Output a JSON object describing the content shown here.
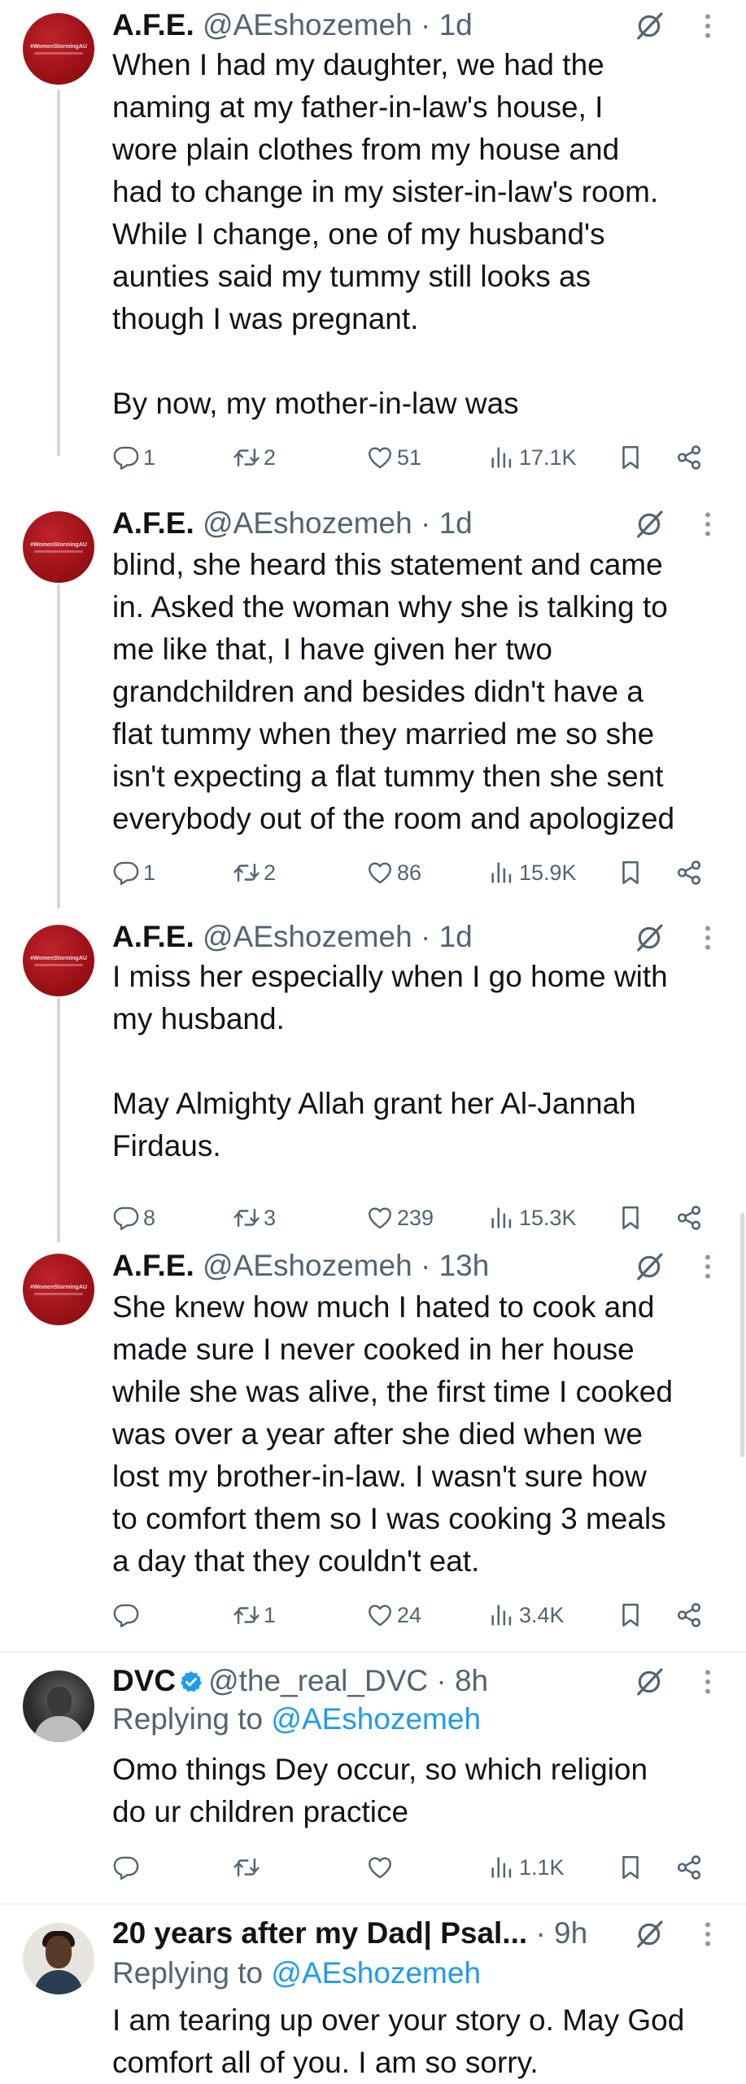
{
  "tweets": [
    {
      "name": "A.F.E.",
      "handle": "@AEshozemeh",
      "time": "1d",
      "avatar_text": "#WomenStormingAU",
      "text": "When I had my daughter, we had the\nnaming at my father-in-law's house, I\nwore plain clothes from my house and\nhad to change in my sister-in-law's room.\nWhile I change, one of my husband's\naunties said my tummy still looks as\nthough I was pregnant.\n\nBy now, my mother-in-law was",
      "replies": "1",
      "retweets": "2",
      "likes": "51",
      "views": "17.1K"
    },
    {
      "name": "A.F.E.",
      "handle": "@AEshozemeh",
      "time": "1d",
      "avatar_text": "#WomenStormingAU",
      "text": "blind, she heard this statement and came\nin. Asked the woman why she is talking to\nme like that, I have given her two\ngrandchildren and besides didn't have a\nflat tummy when they married me so she\nisn't expecting a flat tummy then she sent\neverybody out of the room and apologized",
      "replies": "1",
      "retweets": "2",
      "likes": "86",
      "views": "15.9K"
    },
    {
      "name": "A.F.E.",
      "handle": "@AEshozemeh",
      "time": "1d",
      "avatar_text": "#WomenStormingAU",
      "text": "I miss her especially when I go home with\nmy husband.\n\nMay Almighty Allah grant her Al-Jannah\nFirdaus.",
      "replies": "8",
      "retweets": "3",
      "likes": "239",
      "views": "15.3K"
    },
    {
      "name": "A.F.E.",
      "handle": "@AEshozemeh",
      "time": "13h",
      "avatar_text": "#WomenStormingAU",
      "text": "She knew how much I hated to cook and\nmade sure I never cooked in her house\nwhile she was alive, the first time I cooked\nwas over a year after she died when we\nlost my brother-in-law. I wasn't sure how\nto comfort them so I was cooking 3 meals\na day that they couldn't eat.",
      "replies": "",
      "retweets": "1",
      "likes": "24",
      "views": "3.4K"
    },
    {
      "name": "DVC",
      "handle": "@the_real_DVC",
      "time": "8h",
      "replying_prefix": "Replying to",
      "replying_to": "@AEshozemeh",
      "text": "Omo things Dey occur, so which religion\ndo ur children practice",
      "replies": "",
      "retweets": "",
      "likes": "",
      "views": "1.1K",
      "accent": "#1d9bf0"
    },
    {
      "name": "20 years after my Dad| Psal...",
      "handle": "",
      "time": "9h",
      "replying_prefix": "Replying to",
      "replying_to": "@AEshozemeh",
      "text": "I am tearing up over your story o. May God\ncomfort all of you. I am so sorry."
    }
  ],
  "separator": "·",
  "colors": {
    "text": "#0f1419",
    "secondary": "#536471",
    "link": "#1d9bf0",
    "avatar_red": "#9b1116",
    "divider": "#eff3f4"
  },
  "icons": [
    "reply-icon",
    "retweet-icon",
    "like-icon",
    "views-icon",
    "bookmark-icon",
    "share-icon",
    "grok-icon",
    "more-icon",
    "verified-badge-icon"
  ]
}
